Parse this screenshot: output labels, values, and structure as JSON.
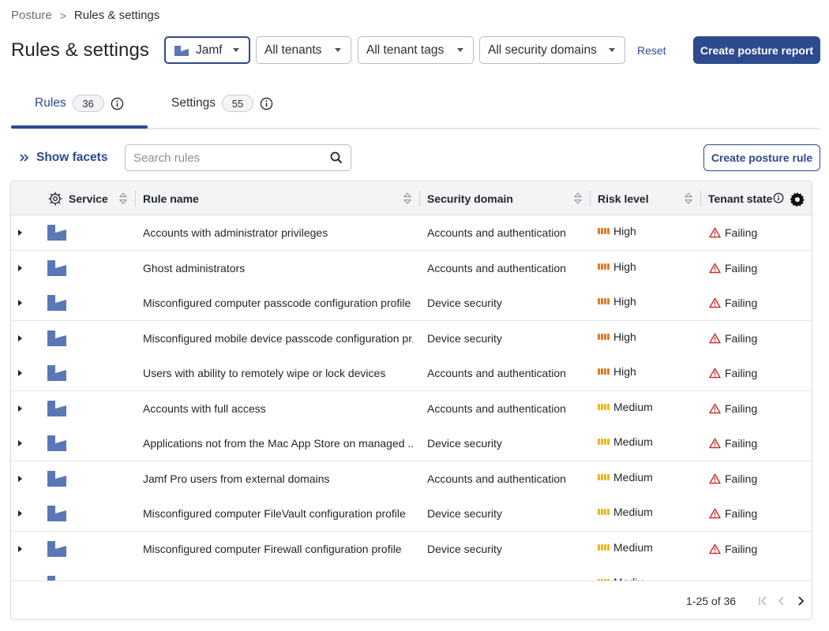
{
  "breadcrumb": {
    "parent": "Posture",
    "separator": ">",
    "current": "Rules & settings"
  },
  "page": {
    "title": "Rules & settings"
  },
  "filters": {
    "service": "Jamf",
    "tenants": "All tenants",
    "tenant_tags": "All tenant tags",
    "security_domains": "All security domains",
    "reset": "Reset"
  },
  "actions": {
    "create_report": "Create posture report",
    "create_rule": "Create posture rule"
  },
  "tabs": [
    {
      "label": "Rules",
      "count": "36",
      "active": true
    },
    {
      "label": "Settings",
      "count": "55",
      "active": false
    }
  ],
  "facets": {
    "label": "Show facets"
  },
  "search": {
    "placeholder": "Search rules",
    "value": ""
  },
  "table": {
    "columns": {
      "service": "Service",
      "rule_name": "Rule name",
      "security_domain": "Security domain",
      "risk_level": "Risk level",
      "tenant_state": "Tenant state"
    },
    "rows": [
      {
        "service": "Jamf",
        "rule": "Accounts with administrator privileges",
        "domain": "Accounts and authentication",
        "risk": "High",
        "state": "Failing"
      },
      {
        "service": "Jamf",
        "rule": "Ghost administrators",
        "domain": "Accounts and authentication",
        "risk": "High",
        "state": "Failing"
      },
      {
        "service": "Jamf",
        "rule": "Misconfigured computer passcode configuration profile",
        "domain": "Device security",
        "risk": "High",
        "state": "Failing"
      },
      {
        "service": "Jamf",
        "rule": "Misconfigured mobile device passcode configuration pr...",
        "domain": "Device security",
        "risk": "High",
        "state": "Failing"
      },
      {
        "service": "Jamf",
        "rule": "Users with ability to remotely wipe or lock devices",
        "domain": "Accounts and authentication",
        "risk": "High",
        "state": "Failing"
      },
      {
        "service": "Jamf",
        "rule": "Accounts with full access",
        "domain": "Accounts and authentication",
        "risk": "Medium",
        "state": "Failing"
      },
      {
        "service": "Jamf",
        "rule": "Applications not from the Mac App Store on managed ...",
        "domain": "Device security",
        "risk": "Medium",
        "state": "Failing"
      },
      {
        "service": "Jamf",
        "rule": "Jamf Pro users from external domains",
        "domain": "Accounts and authentication",
        "risk": "Medium",
        "state": "Failing"
      },
      {
        "service": "Jamf",
        "rule": "Misconfigured computer FileVault configuration profile",
        "domain": "Device security",
        "risk": "Medium",
        "state": "Failing"
      },
      {
        "service": "Jamf",
        "rule": "Misconfigured computer Firewall configuration profile",
        "domain": "Device security",
        "risk": "Medium",
        "state": "Failing"
      }
    ],
    "partial_row": {
      "risk": "Mediu"
    }
  },
  "pagination": {
    "range": "1-25 of 36"
  },
  "colors": {
    "primary": "#2d4a8e",
    "risk_high": "#e07b2a",
    "risk_medium": "#e8b824",
    "failing": "#c92a2a"
  },
  "icons": {
    "service_header": "settings-cog-icon",
    "service_row": "jamf-logo-icon",
    "failing": "warning-triangle-icon",
    "info": "info-icon",
    "settings": "gear-icon",
    "search": "search-icon"
  }
}
